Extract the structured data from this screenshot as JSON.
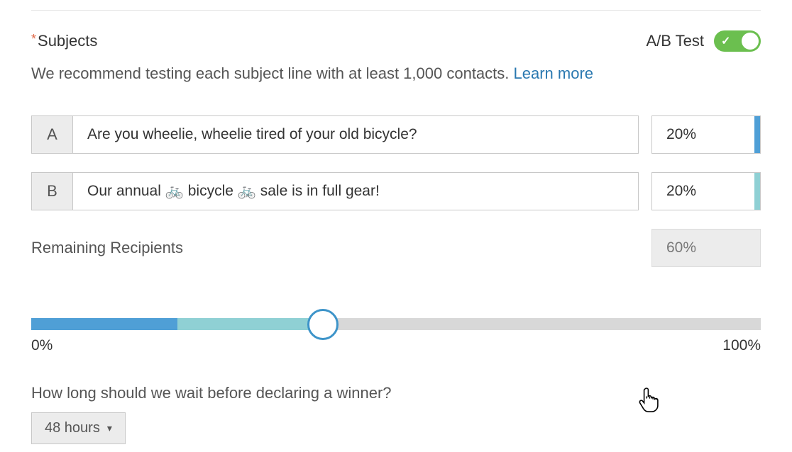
{
  "header": {
    "section_label": "Subjects",
    "required_marker": "*",
    "abtest_label": "A/B Test",
    "toggle_on": true
  },
  "help": {
    "text": "We recommend testing each subject line with at least 1,000 contacts. ",
    "learn_more": "Learn more"
  },
  "variants": {
    "a": {
      "letter": "A",
      "subject": "Are you wheelie, wheelie tired of your old bicycle?",
      "percent": "20%",
      "stripe_color": "#4f9fd6"
    },
    "b": {
      "letter": "B",
      "subject": "Our annual 🚲 bicycle 🚲 sale is in full gear!",
      "percent": "20%",
      "stripe_color": "#8fd0d4"
    }
  },
  "remaining": {
    "label": "Remaining Recipients",
    "percent": "60%"
  },
  "slider": {
    "min_label": "0%",
    "max_label": "100%",
    "a_pct": 20,
    "b_pct": 20,
    "handle_pct": 40
  },
  "winner": {
    "question": "How long should we wait before declaring a winner?",
    "selected": "48 hours"
  }
}
